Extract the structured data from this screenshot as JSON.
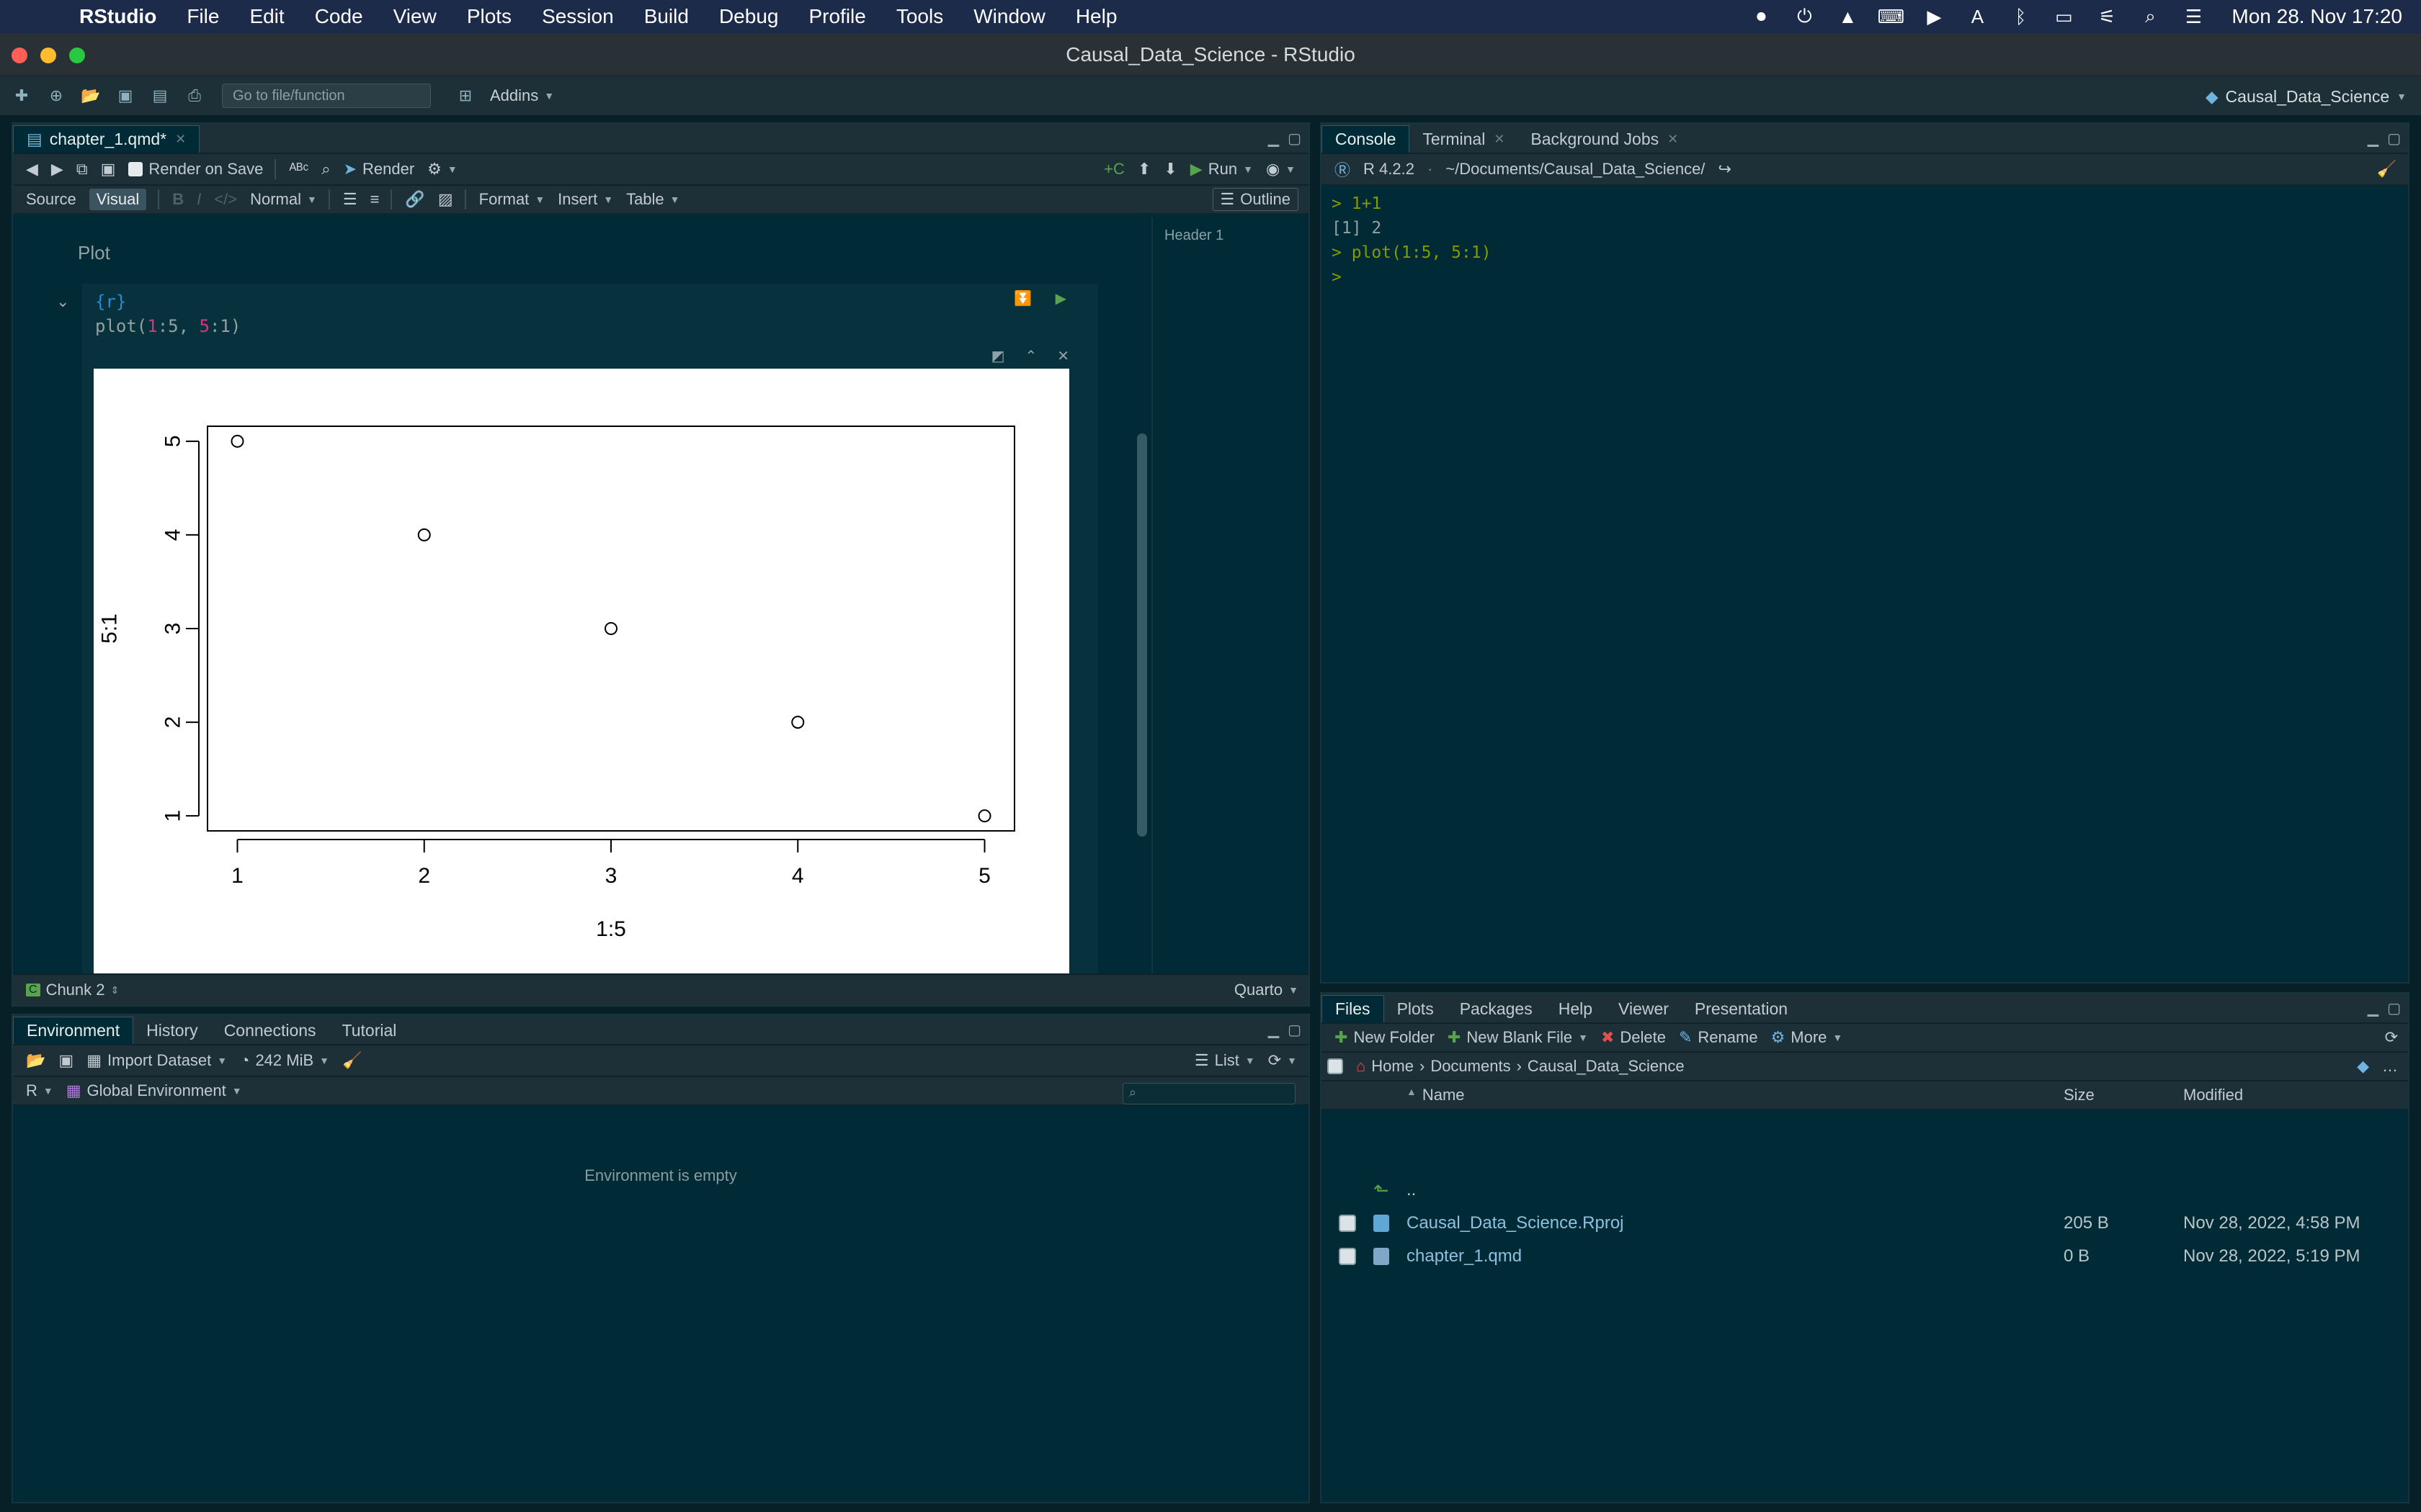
{
  "menubar": {
    "app_name": "RStudio",
    "items": [
      "File",
      "Edit",
      "Code",
      "View",
      "Plots",
      "Session",
      "Build",
      "Debug",
      "Profile",
      "Tools",
      "Window",
      "Help"
    ],
    "clock": "Mon 28. Nov  17:20"
  },
  "window": {
    "title": "Causal_Data_Science - RStudio"
  },
  "toolbar": {
    "goto_placeholder": "Go to file/function",
    "addins_label": "Addins",
    "project_label": "Causal_Data_Science"
  },
  "editor": {
    "tab_label": "chapter_1.qmd*",
    "render_on_save": "Render on Save",
    "render_label": "Render",
    "run_label": "Run",
    "source_label": "Source",
    "visual_label": "Visual",
    "style_select": "Normal",
    "format_label": "Format",
    "insert_label": "Insert",
    "table_label": "Table",
    "outline_label": "Outline",
    "outline_header": "Header 1",
    "heading_text": "Plot",
    "chunk_header": "{r}",
    "chunk_code_fn": "plot(",
    "chunk_code_a": "1",
    "chunk_code_b": ":5, ",
    "chunk_code_c": "5",
    "chunk_code_d": ":1)",
    "status_chunk": "Chunk 2",
    "status_lang": "Quarto"
  },
  "chart_data": {
    "type": "scatter",
    "x": [
      1,
      2,
      3,
      4,
      5
    ],
    "y": [
      5,
      4,
      3,
      2,
      1
    ],
    "xlabel": "1:5",
    "ylabel": "5:1",
    "xticks": [
      "1",
      "2",
      "3",
      "4",
      "5"
    ],
    "yticks": [
      "1",
      "2",
      "3",
      "4",
      "5"
    ],
    "xlim": [
      0.84,
      5.16
    ],
    "ylim": [
      0.84,
      5.16
    ],
    "marker": "open-circle"
  },
  "console": {
    "tabs": [
      {
        "label": "Console"
      },
      {
        "label": "Terminal"
      },
      {
        "label": "Background Jobs"
      }
    ],
    "r_version": "R 4.2.2",
    "path": "~/Documents/Causal_Data_Science/",
    "lines": [
      {
        "type": "input",
        "text": "> 1+1"
      },
      {
        "type": "output",
        "text": "[1] 2"
      },
      {
        "type": "input",
        "text": "> plot(1:5, 5:1)"
      },
      {
        "type": "input",
        "text": ">"
      }
    ]
  },
  "environment": {
    "tabs": [
      "Environment",
      "History",
      "Connections",
      "Tutorial"
    ],
    "import_label": "Import Dataset",
    "memory": "242 MiB",
    "view_mode": "List",
    "lang": "R",
    "scope": "Global Environment",
    "empty_text": "Environment is empty"
  },
  "files": {
    "tabs": [
      "Files",
      "Plots",
      "Packages",
      "Help",
      "Viewer",
      "Presentation"
    ],
    "actions": {
      "new_folder": "New Folder",
      "new_blank": "New Blank File",
      "delete": "Delete",
      "rename": "Rename",
      "more": "More"
    },
    "breadcrumb": [
      "Home",
      "Documents",
      "Causal_Data_Science"
    ],
    "columns": {
      "name": "Name",
      "size": "Size",
      "modified": "Modified"
    },
    "parent": "..",
    "rows": [
      {
        "name": "Causal_Data_Science.Rproj",
        "size": "205 B",
        "modified": "Nov 28, 2022, 4:58 PM"
      },
      {
        "name": "chapter_1.qmd",
        "size": "0 B",
        "modified": "Nov 28, 2022, 5:19 PM"
      }
    ]
  }
}
